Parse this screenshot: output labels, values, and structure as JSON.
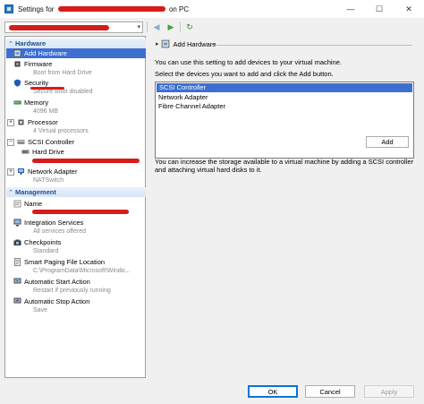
{
  "window": {
    "title_prefix": "Settings for",
    "title_suffix": "on PC",
    "minimize": "—",
    "maximize": "☐",
    "close": "✕"
  },
  "toolbar": {
    "back_icon": "◀",
    "forward_icon": "▶",
    "refresh_icon": "↻",
    "dropdown_arrow": "▾"
  },
  "sidebar": {
    "hardware_header": "Hardware",
    "management_header": "Management",
    "collapse_glyph": "⌃",
    "expand_glyph": "⊞",
    "items": {
      "add_hardware": {
        "label": "Add Hardware"
      },
      "firmware": {
        "label": "Firmware",
        "sub": "Boot from Hard Drive"
      },
      "security": {
        "label": "Security",
        "sub": "Secure Boot disabled"
      },
      "memory": {
        "label": "Memory",
        "sub": "4096 MB"
      },
      "processor": {
        "label": "Processor",
        "sub": "4 Virtual processors"
      },
      "scsi": {
        "label": "SCSI Controller"
      },
      "hard_drive": {
        "label": "Hard Drive"
      },
      "network": {
        "label": "Network Adapter",
        "sub": "NATSwitch"
      },
      "name": {
        "label": "Name"
      },
      "integration": {
        "label": "Integration Services",
        "sub": "All services offered"
      },
      "checkpoints": {
        "label": "Checkpoints",
        "sub": "Standard"
      },
      "smart_paging": {
        "label": "Smart Paging File Location",
        "sub": "C:\\ProgramData\\Microsoft\\Windo..."
      },
      "auto_start": {
        "label": "Automatic Start Action",
        "sub": "Restart if previously running"
      },
      "auto_stop": {
        "label": "Automatic Stop Action",
        "sub": "Save"
      }
    },
    "expanders": {
      "processor": "+",
      "scsi": "−",
      "network": "+"
    }
  },
  "main": {
    "section_title": "Add Hardware",
    "intro": "You can use this setting to add devices to your virtual machine.",
    "instruction": "Select the devices you want to add and click the Add button.",
    "devices": [
      "SCSI Controller",
      "Network Adapter",
      "Fibre Channel Adapter"
    ],
    "selected_device": "SCSI Controller",
    "add_button": "Add",
    "note_line1": "You can increase the storage available to a virtual machine by adding a SCSI controller",
    "note_line2": "and attaching virtual hard disks to it."
  },
  "footer": {
    "ok": "OK",
    "cancel": "Cancel",
    "apply": "Apply"
  },
  "colors": {
    "selection": "#3d6fd1",
    "header_text": "#1f4f8f",
    "redaction": "#d81b1b"
  }
}
